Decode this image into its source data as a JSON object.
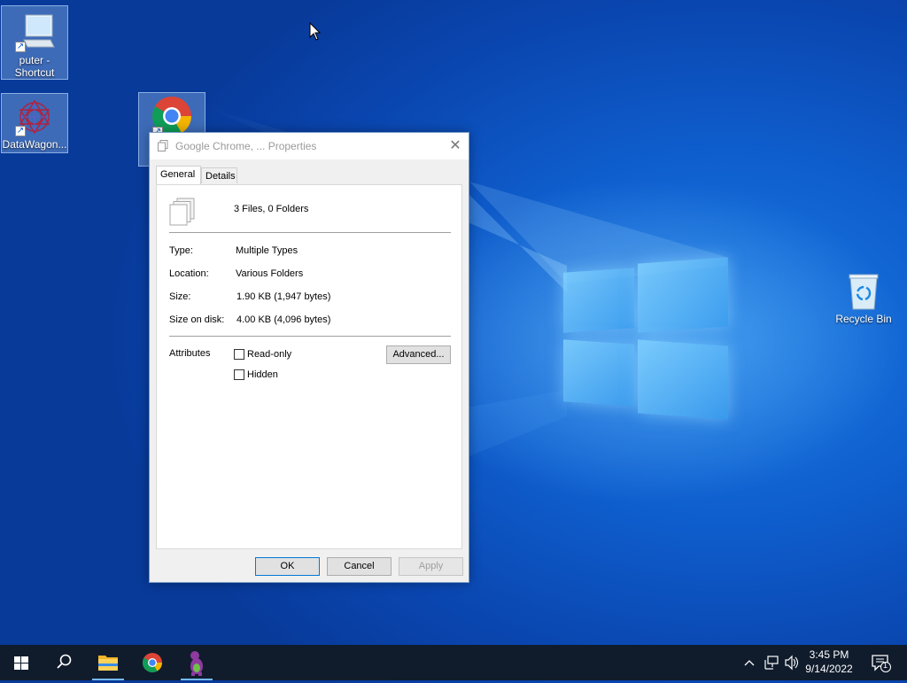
{
  "desktop": {
    "icons": [
      {
        "label": "puter - Shortcut",
        "icon": "computer-icon"
      },
      {
        "label": "DataWagon...",
        "icon": "datawagon-icon"
      },
      {
        "label": "",
        "icon": "chrome-icon"
      },
      {
        "label": "Recycle Bin",
        "icon": "recycle-bin-icon"
      }
    ]
  },
  "dialog": {
    "title": "Google Chrome, ... Properties",
    "close_glyph": "✕",
    "tabs": [
      {
        "label": "General",
        "active": true
      },
      {
        "label": "Details",
        "active": false
      }
    ],
    "summary": "3 Files, 0 Folders",
    "properties": [
      {
        "label": "Type:",
        "value": "Multiple Types"
      },
      {
        "label": "Location:",
        "value": "Various Folders"
      },
      {
        "label": "Size:",
        "value": "1.90 KB (1,947 bytes)"
      },
      {
        "label": "Size on disk:",
        "value": "4.00 KB (4,096 bytes)"
      }
    ],
    "attributes": {
      "label": "Attributes",
      "read_only": {
        "label": "Read-only",
        "checked": false
      },
      "hidden": {
        "label": "Hidden",
        "checked": false
      },
      "advanced_button": "Advanced..."
    },
    "buttons": {
      "ok": "OK",
      "cancel": "Cancel",
      "apply": "Apply"
    }
  },
  "taskbar": {
    "items": [
      "start-icon",
      "search-icon",
      "file-explorer-icon",
      "chrome-icon",
      "barney-app-icon"
    ],
    "clock": {
      "time": "3:45 PM",
      "date": "9/14/2022"
    },
    "notification_count": "1"
  },
  "colors": {
    "desktop": "#0f5fcf",
    "taskbar": "#101c2c",
    "dialog_border": "#7a9cc7",
    "accent": "#76b9ed"
  }
}
